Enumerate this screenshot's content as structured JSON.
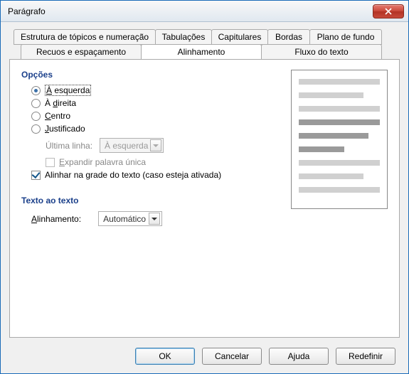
{
  "window": {
    "title": "Parágrafo"
  },
  "tabs": {
    "row1": [
      "Estrutura de tópicos e numeração",
      "Tabulações",
      "Capitulares",
      "Bordas",
      "Plano de fundo"
    ],
    "row2": [
      "Recuos e espaçamento",
      "Alinhamento",
      "Fluxo do texto"
    ],
    "active": "Alinhamento"
  },
  "sections": {
    "options_title": "Opções",
    "radios": {
      "left": "À esquerda",
      "right": "À direita",
      "center": "Centro",
      "justified": "Justificado",
      "selected": "left"
    },
    "last_line": {
      "label": "Última linha:",
      "value": "À esquerda"
    },
    "expand_single": {
      "label": "Expandir palavra única",
      "checked": false
    },
    "snap_grid": {
      "label": "Alinhar na grade do texto (caso esteja ativada)",
      "checked": true
    },
    "text_to_text_title": "Texto ao texto",
    "alignment": {
      "label": "Alinhamento:",
      "value": "Automático"
    }
  },
  "buttons": {
    "ok": "OK",
    "cancel": "Cancelar",
    "help": "Ajuda",
    "reset": "Redefinir"
  }
}
